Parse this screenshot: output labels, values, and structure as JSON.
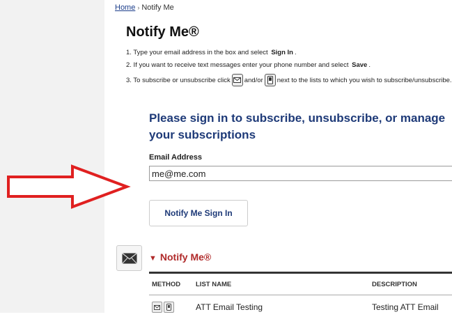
{
  "breadcrumb": {
    "home": "Home",
    "separator": "›",
    "current": "Notify Me"
  },
  "page_title": "Notify Me®",
  "steps": {
    "s1_pre": "1. Type your email address in the box and select",
    "s1_bold": "Sign In",
    "s1_post": ".",
    "s2_pre": "2. If you want to receive text messages enter your phone number and select",
    "s2_bold": "Save",
    "s2_post": ".",
    "s3_pre": "3. To subscribe or unsubscribe click",
    "s3_mid": "and/or",
    "s3_post": "next to the lists to which you wish to subscribe/unsubscribe."
  },
  "signin": {
    "heading": "Please sign in to subscribe, unsubscribe, or manage your subscriptions",
    "email_label": "Email Address",
    "email_value": "me@me.com",
    "button_label": "Notify Me Sign In"
  },
  "list_section": {
    "title": "Notify Me®",
    "columns": {
      "method": "METHOD",
      "list_name": "LIST NAME",
      "description": "DESCRIPTION"
    },
    "rows": [
      {
        "list_name": "ATT Email Testing",
        "description": "Testing ATT Email"
      }
    ]
  },
  "icons": {
    "envelope": "envelope-icon",
    "phone": "phone-icon",
    "arrow": "arrow-right-icon"
  },
  "colors": {
    "heading_blue": "#1e3a78",
    "section_red": "#b02a2a",
    "arrow_red": "#e02020"
  }
}
